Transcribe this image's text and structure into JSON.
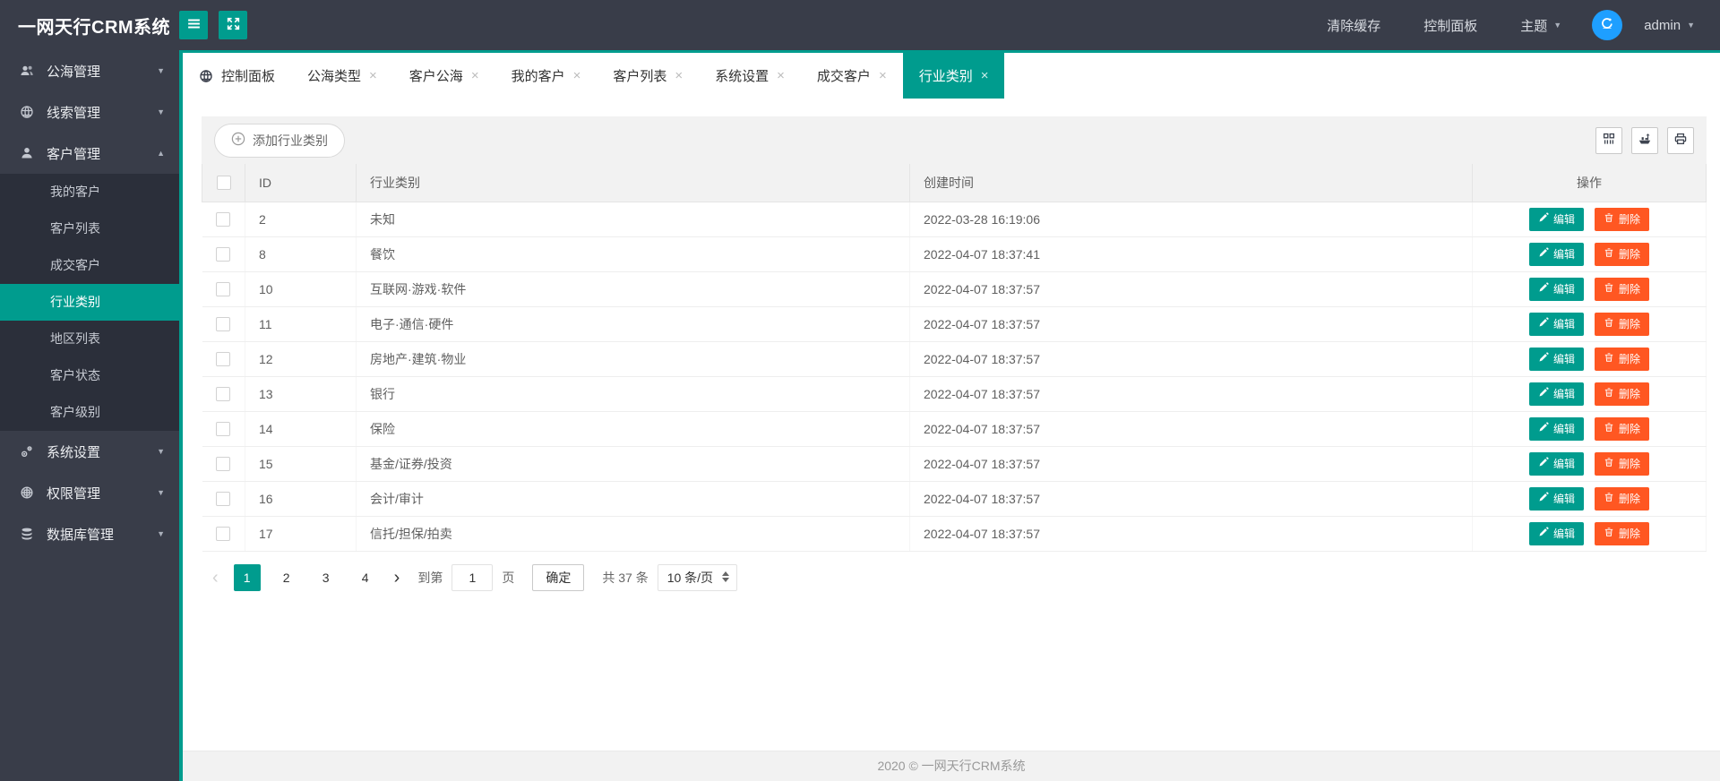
{
  "navbar": {
    "logo": "一网天行CRM系统",
    "clear_cache": "清除缓存",
    "control_panel": "控制面板",
    "theme": "主题",
    "username": "admin"
  },
  "sidebar": {
    "items": [
      {
        "label": "公海管理"
      },
      {
        "label": "线索管理"
      },
      {
        "label": "客户管理",
        "children": [
          "我的客户",
          "客户列表",
          "成交客户",
          "行业类别",
          "地区列表",
          "客户状态",
          "客户级别"
        ],
        "active_child": "行业类别"
      },
      {
        "label": "系统设置"
      },
      {
        "label": "权限管理"
      },
      {
        "label": "数据库管理"
      }
    ]
  },
  "tabs": [
    {
      "label": "控制面板"
    },
    {
      "label": "公海类型"
    },
    {
      "label": "客户公海"
    },
    {
      "label": "我的客户"
    },
    {
      "label": "客户列表"
    },
    {
      "label": "系统设置"
    },
    {
      "label": "成交客户"
    },
    {
      "label": "行业类别",
      "active": true
    }
  ],
  "toolbar": {
    "add_button": "添加行业类别"
  },
  "table": {
    "headers": {
      "id": "ID",
      "name": "行业类别",
      "time": "创建时间",
      "actions": "操作"
    },
    "edit_label": "编辑",
    "delete_label": "删除",
    "rows": [
      {
        "id": "2",
        "name": "未知",
        "time": "2022-03-28 16:19:06"
      },
      {
        "id": "8",
        "name": "餐饮",
        "time": "2022-04-07 18:37:41"
      },
      {
        "id": "10",
        "name": "互联网·游戏·软件",
        "time": "2022-04-07 18:37:57"
      },
      {
        "id": "11",
        "name": "电子·通信·硬件",
        "time": "2022-04-07 18:37:57"
      },
      {
        "id": "12",
        "name": "房地产·建筑·物业",
        "time": "2022-04-07 18:37:57"
      },
      {
        "id": "13",
        "name": "银行",
        "time": "2022-04-07 18:37:57"
      },
      {
        "id": "14",
        "name": "保险",
        "time": "2022-04-07 18:37:57"
      },
      {
        "id": "15",
        "name": "基金/证券/投资",
        "time": "2022-04-07 18:37:57"
      },
      {
        "id": "16",
        "name": "会计/审计",
        "time": "2022-04-07 18:37:57"
      },
      {
        "id": "17",
        "name": "信托/担保/拍卖",
        "time": "2022-04-07 18:37:57"
      }
    ]
  },
  "pagination": {
    "pages": [
      "1",
      "2",
      "3",
      "4"
    ],
    "active_page": "1",
    "goto_label": "到第",
    "goto_value": "1",
    "page_unit": "页",
    "confirm_label": "确定",
    "total_label": "共 37 条",
    "page_size": "10 条/页"
  },
  "footer": {
    "text": "2020 ©  一网天行CRM系统"
  },
  "icons": {
    "caret_down": "▼",
    "caret_up": "▲",
    "close": "×",
    "chevron_left": "‹",
    "chevron_right": "›"
  },
  "colors": {
    "accent": "#009C8E",
    "danger": "#FF5722",
    "avatar_bg": "#1E9FFF",
    "header_bg": "#393D49"
  }
}
